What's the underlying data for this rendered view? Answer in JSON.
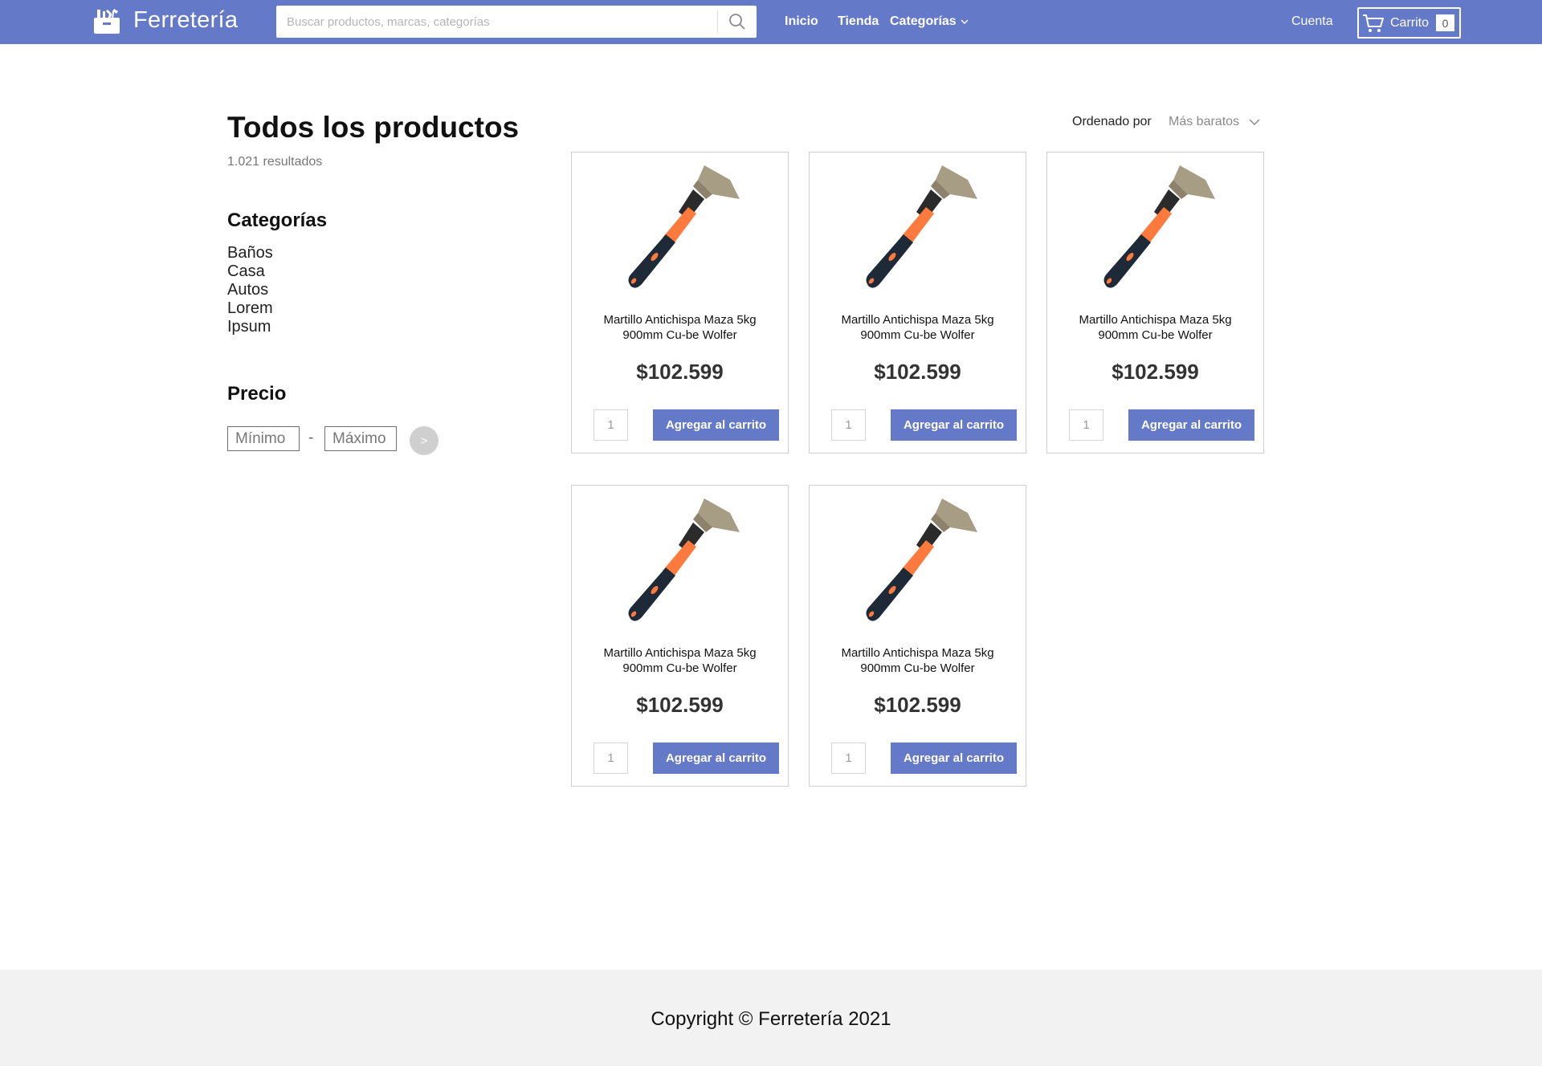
{
  "navbar": {
    "brand": "Ferretería",
    "search_placeholder": "Buscar productos, marcas, categorías",
    "links": {
      "inicio": "Inicio",
      "tienda": "Tienda",
      "categorias": "Categorías"
    },
    "account": "Cuenta",
    "cart_label": "Carrito",
    "cart_count": "0",
    "color": "#6479c8"
  },
  "main": {
    "title": "Todos los productos",
    "results": "1.021 resultados",
    "sort_label": "Ordenado por",
    "sort_value": "Más baratos"
  },
  "sidebar": {
    "categories_heading": "Categorías",
    "categories": [
      "Baños",
      "Casa",
      "Autos",
      "Lorem",
      "Ipsum"
    ],
    "price_heading": "Precio",
    "min_placeholder": "Mínimo",
    "max_placeholder": "Máximo",
    "dash": "-",
    "go_label": ">"
  },
  "products": [
    {
      "name": "Martillo Antichispa Maza 5kg 900mm Cu-be Wolfer",
      "price": "$102.599",
      "qty": "1",
      "button": "Agregar al carrito",
      "image_icon": "hammer-icon"
    },
    {
      "name": "Martillo Antichispa Maza 5kg 900mm Cu-be Wolfer",
      "price": "$102.599",
      "qty": "1",
      "button": "Agregar al carrito",
      "image_icon": "hammer-icon"
    },
    {
      "name": "Martillo Antichispa Maza 5kg 900mm Cu-be Wolfer",
      "price": "$102.599",
      "qty": "1",
      "button": "Agregar al carrito",
      "image_icon": "hammer-icon"
    },
    {
      "name": "Martillo Antichispa Maza 5kg 900mm Cu-be Wolfer",
      "price": "$102.599",
      "qty": "1",
      "button": "Agregar al carrito",
      "image_icon": "hammer-icon"
    },
    {
      "name": "Martillo Antichispa Maza 5kg 900mm Cu-be Wolfer",
      "price": "$102.599",
      "qty": "1",
      "button": "Agregar al carrito",
      "image_icon": "hammer-icon"
    }
  ],
  "footer": {
    "copyright": "Copyright © Ferretería 2021"
  }
}
